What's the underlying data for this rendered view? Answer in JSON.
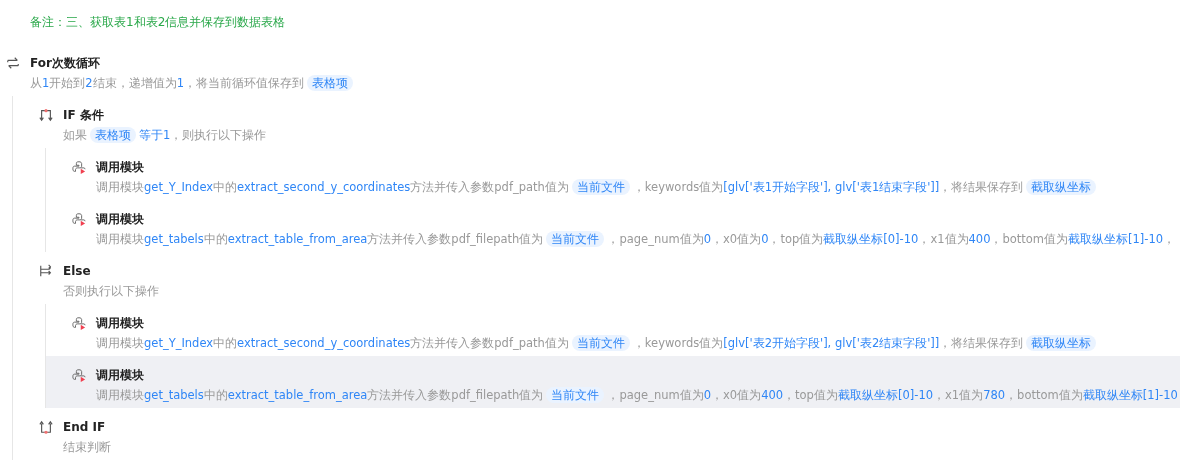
{
  "note": "备注：三、获取表1和表2信息并保存到数据表格",
  "steps": [
    {
      "kind": "loop",
      "title": "For次数循环",
      "selected": false,
      "desc": [
        {
          "kind": "text",
          "t": "从"
        },
        {
          "kind": "value",
          "t": "1"
        },
        {
          "kind": "text",
          "t": "开始到"
        },
        {
          "kind": "value",
          "t": "2"
        },
        {
          "kind": "text",
          "t": "结束，递增值为"
        },
        {
          "kind": "value",
          "t": "1"
        },
        {
          "kind": "text",
          "t": "，将当前循环值保存到"
        },
        {
          "kind": "var",
          "t": "表格项"
        }
      ],
      "children": [
        {
          "kind": "if",
          "title": "IF 条件",
          "selected": false,
          "desc": [
            {
              "kind": "text",
              "t": "如果"
            },
            {
              "kind": "var",
              "t": "表格项"
            },
            {
              "kind": "value",
              "t": "等于1"
            },
            {
              "kind": "text",
              "t": "，则执行以下操作"
            }
          ],
          "children": [
            {
              "kind": "call",
              "title": "调用模块",
              "selected": false,
              "desc": [
                {
                  "kind": "text",
                  "t": "调用模块"
                },
                {
                  "kind": "value",
                  "t": "get_Y_Index"
                },
                {
                  "kind": "text",
                  "t": "中的"
                },
                {
                  "kind": "value",
                  "t": "extract_second_y_coordinates"
                },
                {
                  "kind": "text",
                  "t": "方法并传入参数pdf_path值为"
                },
                {
                  "kind": "var",
                  "t": "当前文件"
                },
                {
                  "kind": "text",
                  "t": "，keywords值为"
                },
                {
                  "kind": "value",
                  "t": "[glv['表1开始字段'], glv['表1结束字段']]"
                },
                {
                  "kind": "text",
                  "t": "，将结果保存到"
                },
                {
                  "kind": "var",
                  "t": "截取纵坐标"
                }
              ]
            },
            {
              "kind": "call",
              "title": "调用模块",
              "selected": false,
              "desc": [
                {
                  "kind": "text",
                  "t": "调用模块"
                },
                {
                  "kind": "value",
                  "t": "get_tabels"
                },
                {
                  "kind": "text",
                  "t": "中的"
                },
                {
                  "kind": "value",
                  "t": "extract_table_from_area"
                },
                {
                  "kind": "text",
                  "t": "方法并传入参数pdf_filepath值为"
                },
                {
                  "kind": "var",
                  "t": "当前文件"
                },
                {
                  "kind": "text",
                  "t": "，page_num值为"
                },
                {
                  "kind": "value",
                  "t": "0"
                },
                {
                  "kind": "text",
                  "t": "，x0值为"
                },
                {
                  "kind": "value",
                  "t": "0"
                },
                {
                  "kind": "text",
                  "t": "，top值为"
                },
                {
                  "kind": "value",
                  "t": "截取纵坐标[0]-10"
                },
                {
                  "kind": "text",
                  "t": "，x1值为"
                },
                {
                  "kind": "value",
                  "t": "400"
                },
                {
                  "kind": "text",
                  "t": "，bottom值为"
                },
                {
                  "kind": "value",
                  "t": "截取纵坐标[1]-10"
                },
                {
                  "kind": "text",
                  "t": "，"
                }
              ]
            }
          ]
        },
        {
          "kind": "else",
          "title": "Else",
          "selected": false,
          "desc": [
            {
              "kind": "text",
              "t": "否则执行以下操作"
            }
          ],
          "children": [
            {
              "kind": "call",
              "title": "调用模块",
              "selected": false,
              "desc": [
                {
                  "kind": "text",
                  "t": "调用模块"
                },
                {
                  "kind": "value",
                  "t": "get_Y_Index"
                },
                {
                  "kind": "text",
                  "t": "中的"
                },
                {
                  "kind": "value",
                  "t": "extract_second_y_coordinates"
                },
                {
                  "kind": "text",
                  "t": "方法并传入参数pdf_path值为"
                },
                {
                  "kind": "var",
                  "t": "当前文件"
                },
                {
                  "kind": "text",
                  "t": "，keywords值为"
                },
                {
                  "kind": "value",
                  "t": "[glv['表2开始字段'], glv['表2结束字段']]"
                },
                {
                  "kind": "text",
                  "t": "，将结果保存到"
                },
                {
                  "kind": "var",
                  "t": "截取纵坐标"
                }
              ]
            },
            {
              "kind": "call",
              "title": "调用模块",
              "selected": true,
              "desc": [
                {
                  "kind": "text",
                  "t": "调用模块"
                },
                {
                  "kind": "value",
                  "t": "get_tabels"
                },
                {
                  "kind": "text",
                  "t": "中的"
                },
                {
                  "kind": "value",
                  "t": "extract_table_from_area"
                },
                {
                  "kind": "text",
                  "t": "方法并传入参数pdf_filepath值为"
                },
                {
                  "kind": "var",
                  "t": "当前文件"
                },
                {
                  "kind": "text",
                  "t": "，page_num值为"
                },
                {
                  "kind": "value",
                  "t": "0"
                },
                {
                  "kind": "text",
                  "t": "，x0值为"
                },
                {
                  "kind": "value",
                  "t": "400"
                },
                {
                  "kind": "text",
                  "t": "，top值为"
                },
                {
                  "kind": "value",
                  "t": "截取纵坐标[0]-10"
                },
                {
                  "kind": "text",
                  "t": "，x1值为"
                },
                {
                  "kind": "value",
                  "t": "780"
                },
                {
                  "kind": "text",
                  "t": "，bottom值为"
                },
                {
                  "kind": "value",
                  "t": "截取纵坐标[1]-10"
                }
              ]
            }
          ]
        },
        {
          "kind": "endif",
          "title": "End IF",
          "selected": false,
          "desc": [
            {
              "kind": "text",
              "t": "结束判断"
            }
          ]
        }
      ]
    }
  ]
}
